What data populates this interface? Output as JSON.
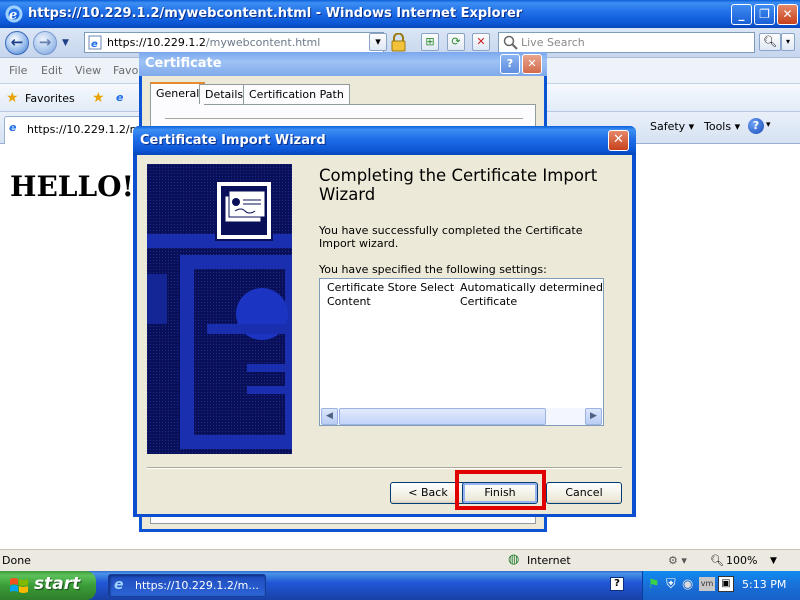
{
  "browser": {
    "title": "https://10.229.1.2/mywebcontent.html - Windows Internet Explorer",
    "address_host": "https://10.229.1.2",
    "address_path": "/mywebcontent.html",
    "search_placeholder": "Live Search",
    "menu": [
      "File",
      "Edit",
      "View",
      "Favo"
    ],
    "favorites_label": "Favorites",
    "tab_label": "https://10.229.1.2/m",
    "toolbar_right": [
      "Safety",
      "Tools"
    ],
    "page_text": "HELLO!",
    "status_text": "Done",
    "zone_text": "Internet",
    "zoom_text": "100%"
  },
  "certificate_dialog": {
    "title": "Certificate",
    "tabs": [
      "General",
      "Details",
      "Certification Path"
    ]
  },
  "wizard": {
    "title": "Certificate Import Wizard",
    "heading": "Completing the Certificate Import Wizard",
    "description": "You have successfully completed the Certificate Import wizard.",
    "settings_label": "You have specified the following settings:",
    "settings": [
      {
        "name": "Certificate Store Selected",
        "value": "Automatically determined by t"
      },
      {
        "name": "Content",
        "value": "Certificate"
      }
    ],
    "buttons": {
      "back": "< Back",
      "finish": "Finish",
      "cancel": "Cancel"
    }
  },
  "taskbar": {
    "start_label": "start",
    "task_item": "https://10.229.1.2/m...",
    "clock": "5:13 PM"
  },
  "colors": {
    "xp_blue": "#0b55d4",
    "dialog_face": "#ece9d8",
    "highlight_red": "#e00000",
    "start_green": "#3c9b3c"
  },
  "icons": [
    "ie-logo-icon",
    "back-arrow-icon",
    "forward-arrow-icon",
    "lock-icon",
    "refresh-icon",
    "stop-icon",
    "search-icon",
    "star-icon",
    "help-icon",
    "certificate-icon",
    "windows-logo-icon",
    "internet-globe-icon",
    "zoom-icon"
  ]
}
